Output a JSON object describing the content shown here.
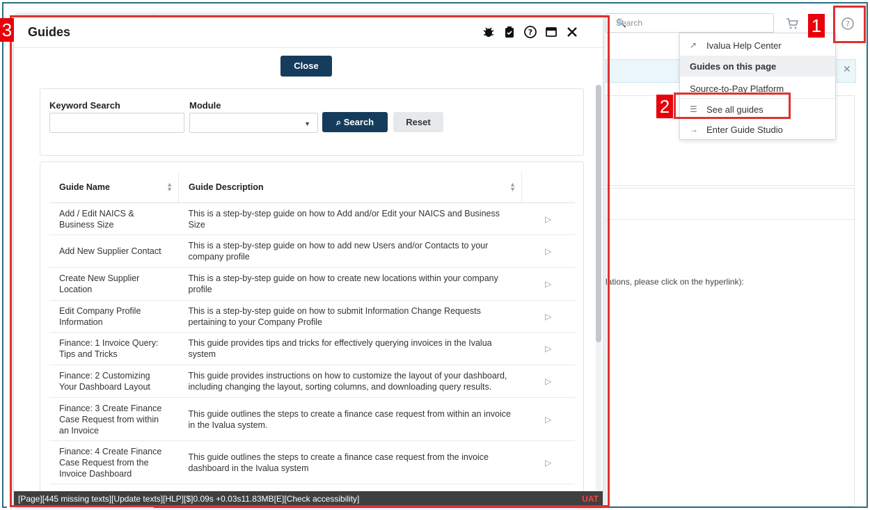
{
  "background": {
    "search_placeholder": "Search",
    "note_text": "lations, please click on the hyperlink):"
  },
  "help_menu": {
    "items": [
      {
        "icon": "external-link-icon",
        "label": "Ivalua Help Center"
      },
      {
        "icon": "",
        "label": "Guides on this page"
      },
      {
        "icon": "",
        "label": "Source-to-Pay Platform"
      },
      {
        "icon": "list-icon",
        "label": "See all guides"
      },
      {
        "icon": "enter-icon",
        "label": "Enter Guide Studio"
      }
    ]
  },
  "annotations": {
    "marker_1": "1",
    "marker_2": "2",
    "marker_3": "3",
    "color": "#e03030"
  },
  "guides_panel": {
    "title": "Guides",
    "header_icons": [
      "bug-icon",
      "clipboard-icon",
      "help-icon",
      "maximize-icon",
      "close-icon"
    ],
    "close_label": "Close",
    "filters": {
      "keyword_label": "Keyword Search",
      "keyword_value": "",
      "module_label": "Module",
      "module_value": "",
      "search_label": "Search",
      "reset_label": "Reset"
    },
    "table": {
      "headers": [
        "Guide Name",
        "Guide Description"
      ],
      "rows": [
        {
          "name": "Add / Edit NAICS & Business Size",
          "description": "This is a step-by-step guide on how to Add and/or Edit your NAICS and Business Size"
        },
        {
          "name": "Add New Supplier Contact",
          "description": "This is a step-by-step guide on how to add new Users and/or Contacts to your company profile"
        },
        {
          "name": "Create New Supplier Location",
          "description": "This is a step-by-step guide on how to create new locations within your company profile"
        },
        {
          "name": "Edit Company Profile Information",
          "description": "This is a step-by-step guide on how to submit Information Change Requests pertaining to your Company Profile"
        },
        {
          "name": "Finance: 1 Invoice Query: Tips and Tricks",
          "description": "This guide provides tips and tricks for effectively querying invoices in the Ivalua system"
        },
        {
          "name": "Finance: 2 Customizing Your Dashboard Layout",
          "description": "This guide provides instructions on how to customize the layout of your dashboard, including changing the layout, sorting columns, and downloading query results."
        },
        {
          "name": "Finance: 3 Create Finance Case Request from within an Invoice",
          "description": "This guide outlines the steps to create a finance case request from within an invoice in the Ivalua system."
        },
        {
          "name": "Finance: 4 Create Finance Case Request from the Invoice Dashboard",
          "description": "This guide outlines the steps to create a finance case request from the invoice dashboard in the Ivalua system"
        }
      ]
    },
    "debug_bar": "[Page][445 missing texts][Update texts][HLP][$]0.09s +0.03s11.83MB[E][Check accessibility]",
    "env_badge": "UAT"
  },
  "colors": {
    "primary": "#153c5c",
    "annotation": "#e03030",
    "frame": "#2a6f80"
  }
}
